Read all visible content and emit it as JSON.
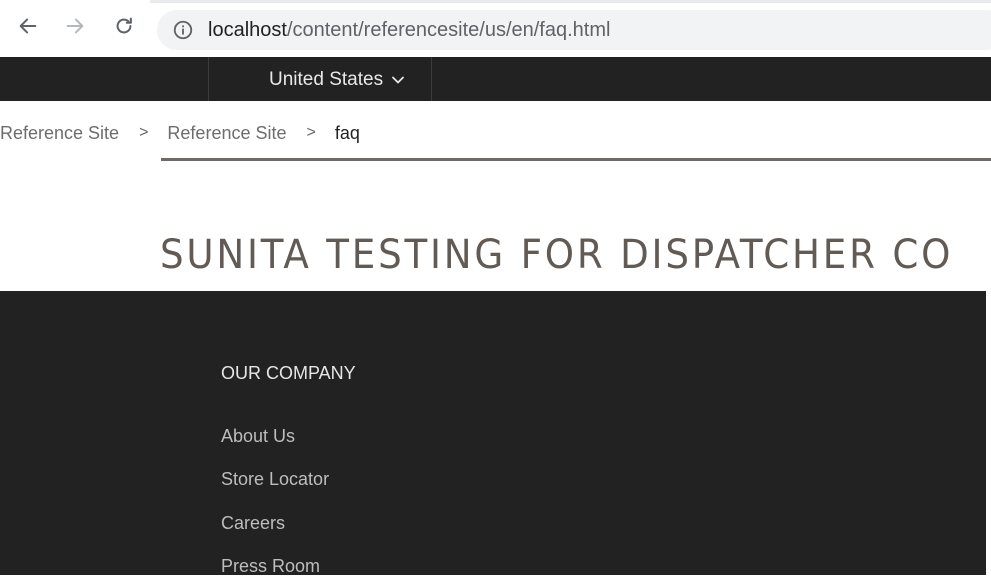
{
  "browser": {
    "url_host": "localhost",
    "url_path": "/content/referencesite/us/en/faq.html",
    "icons": {
      "back": "arrow-left-icon",
      "forward": "arrow-right-icon",
      "reload": "reload-icon",
      "site_info": "info-circle-icon"
    }
  },
  "header": {
    "country": "United States",
    "country_icon": "chevron-down-icon"
  },
  "breadcrumb": {
    "items": [
      "Reference Site",
      "Reference Site"
    ],
    "separator": ">",
    "current": "faq"
  },
  "page": {
    "title": "SUNITA TESTING FOR DISPATCHER CO"
  },
  "footer": {
    "heading": "OUR COMPANY",
    "links": [
      "About Us",
      "Store Locator",
      "Careers",
      "Press Room"
    ]
  },
  "colors": {
    "header_bg": "#222222",
    "footer_bg": "#222222",
    "title": "#625a54",
    "rule": "#6f6a66"
  }
}
